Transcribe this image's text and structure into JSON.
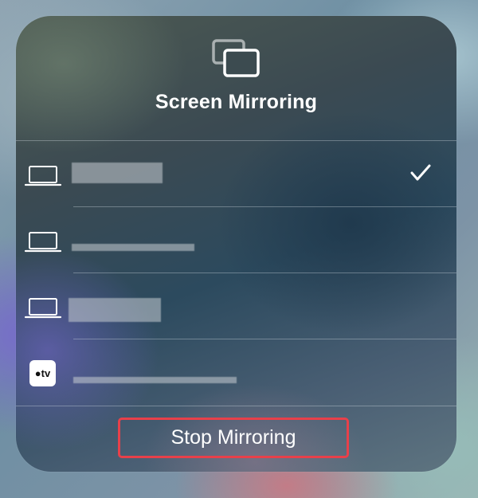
{
  "panel": {
    "title": "Screen Mirroring",
    "header_icon": "screen-mirroring-icon"
  },
  "devices": [
    {
      "type": "laptop",
      "icon": "laptop-icon",
      "name": "",
      "selected": true
    },
    {
      "type": "laptop",
      "icon": "laptop-icon",
      "name": "",
      "selected": false
    },
    {
      "type": "laptop",
      "icon": "laptop-icon",
      "name": "",
      "selected": false
    },
    {
      "type": "apple-tv",
      "icon": "apple-tv-icon",
      "badge_text": "tv",
      "name": "",
      "selected": false
    }
  ],
  "selected_icon": "checkmark-icon",
  "footer": {
    "stop_label": "Stop Mirroring"
  },
  "colors": {
    "highlight_border": "#e8404a",
    "text": "#ffffff",
    "divider": "rgba(220,230,235,0.35)"
  }
}
